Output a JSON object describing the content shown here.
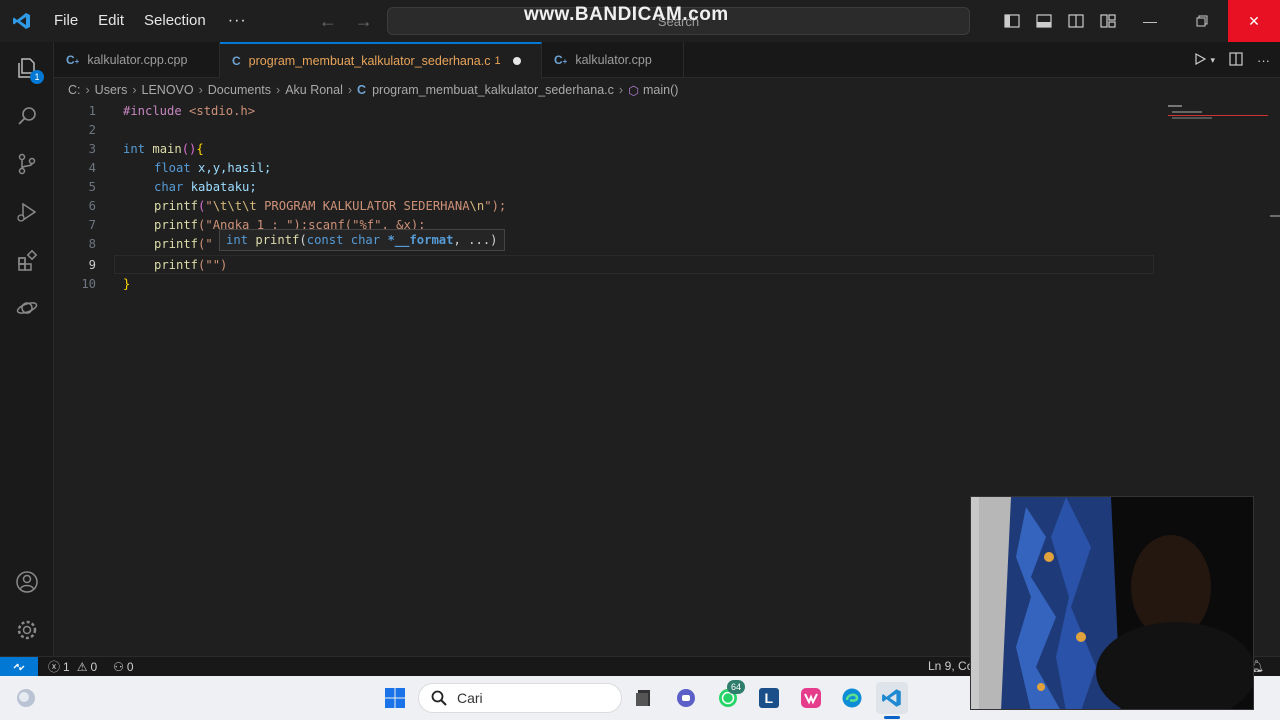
{
  "menu": {
    "file": "File",
    "edit": "Edit",
    "selection": "Selection",
    "more": "···"
  },
  "search": {
    "placeholder": "Search"
  },
  "watermark": "www.BANDICAM.com",
  "tabs": [
    {
      "icon": "C++",
      "label": "kalkulator.cpp.cpp",
      "active": false
    },
    {
      "icon": "C",
      "label": "program_membuat_kalkulator_sederhana.c",
      "problems": "1",
      "unsaved": true,
      "active": true
    },
    {
      "icon": "C++",
      "label": "kalkulator.cpp",
      "active": false
    }
  ],
  "breadcrumb": {
    "items": [
      "C:",
      "Users",
      "LENOVO",
      "Documents",
      "Aku Ronal"
    ],
    "file_icon": "C",
    "file": "program_membuat_kalkulator_sederhana.c",
    "symbol": "main()"
  },
  "editor": {
    "line_numbers": [
      "1",
      "2",
      "3",
      "4",
      "5",
      "6",
      "7",
      "8",
      "9",
      "10"
    ],
    "current_line": 9,
    "lines": {
      "l1_include": "#include",
      "l1_header": " <stdio.h>",
      "l3_int": "int",
      "l3_main": " main",
      "l3_paren": "()",
      "l3_brace": "{",
      "l4_float": "float",
      "l4_vars": " x,y,hasil;",
      "l5_char": "char",
      "l5_var": " kabataku;",
      "l6_fn": "printf",
      "l6_open": "(",
      "l6_str1": "\"",
      "l6_esc": "\\t\\t\\t",
      "l6_str2": " PROGRAM KALKULATOR SEDERHANA",
      "l6_nl": "\\n",
      "l6_close": "\");",
      "l7_fn": "printf",
      "l7_rest": "(\"Angka 1 : \");scanf(\"%f\", &x);",
      "l8_fn": "printf",
      "l8_rest": "(\"",
      "l9_fn": "printf",
      "l9_rest": "(\"\")",
      "l10_brace": "}"
    },
    "hover": {
      "ret": "int",
      "name": " printf",
      "open": "(",
      "const": "const",
      "char": " char",
      "ptr": " *__format",
      "rest": ", ...)"
    }
  },
  "status": {
    "errors": "1",
    "warnings": "0",
    "ports": "0",
    "position": "Ln 9, Co"
  },
  "taskbar": {
    "search_placeholder": "Cari",
    "whatsapp_badge": "64",
    "apps": [
      "start-icon",
      "file-manager-icon",
      "chat-icon",
      "whatsapp-icon",
      "l-app-icon",
      "office-icon",
      "edge-icon",
      "vscode-icon"
    ]
  },
  "colors": {
    "accent": "#0078d4",
    "close": "#e81123",
    "modified_tab": "#e8a45a"
  }
}
